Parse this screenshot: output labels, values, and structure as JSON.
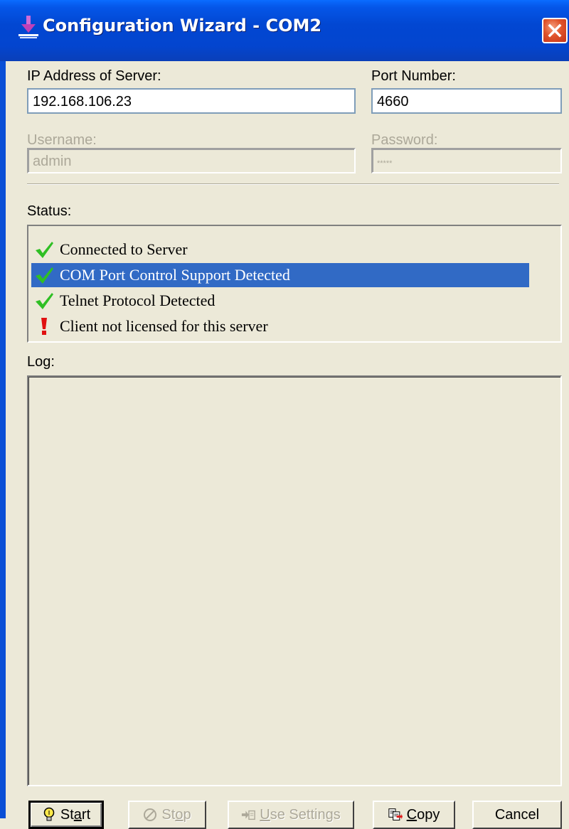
{
  "window": {
    "title": "Configuration Wizard - COM2"
  },
  "server": {
    "ip_label": "IP Address of Server:",
    "ip_value": "192.168.106.23",
    "port_label": "Port Number:",
    "port_value": "4660",
    "username_label": "Username:",
    "username_value": "admin",
    "password_label": "Password:",
    "password_value": "*****"
  },
  "status": {
    "label": "Status:",
    "items": [
      {
        "icon": "check-icon",
        "text": "Connected to Server",
        "selected": false
      },
      {
        "icon": "check-icon",
        "text": "COM Port Control Support Detected",
        "selected": true
      },
      {
        "icon": "check-icon",
        "text": "Telnet Protocol Detected",
        "selected": false
      },
      {
        "icon": "exclamation-icon",
        "text": "Client not licensed for this server",
        "selected": false
      }
    ]
  },
  "log": {
    "label": "Log:"
  },
  "buttons": {
    "start": {
      "pre": "St",
      "accel": "a",
      "post": "rt",
      "enabled": true
    },
    "stop": {
      "pre": "St",
      "accel": "o",
      "post": "p",
      "enabled": false
    },
    "use_settings": {
      "pre": "",
      "accel": "U",
      "post": "se Settings",
      "enabled": false
    },
    "copy": {
      "pre": "",
      "accel": "C",
      "post": "opy",
      "enabled": true
    },
    "cancel": {
      "label": "Cancel",
      "enabled": true
    }
  },
  "colors": {
    "titlebar": "#0247d2",
    "selection": "#316ac5",
    "check": "#2fbf24",
    "exclamation": "#e01010",
    "face": "#ece9d8"
  }
}
